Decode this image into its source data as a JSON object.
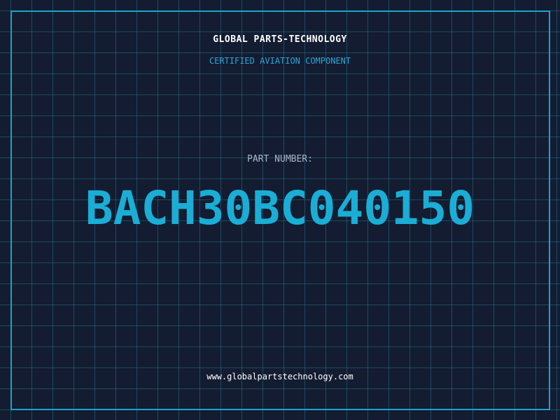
{
  "header": {
    "company": "GLOBAL PARTS-TECHNOLOGY",
    "subtitle": "CERTIFIED AVIATION COMPONENT"
  },
  "part": {
    "label": "PART NUMBER:",
    "number": "BACH30BC040150"
  },
  "footer": {
    "website": "www.globalpartstechnology.com"
  },
  "colors": {
    "background": "#131c30",
    "grid": "#286e8c",
    "accent": "#1aaed6",
    "text": "#ffffff",
    "label": "#a8b4c4"
  }
}
